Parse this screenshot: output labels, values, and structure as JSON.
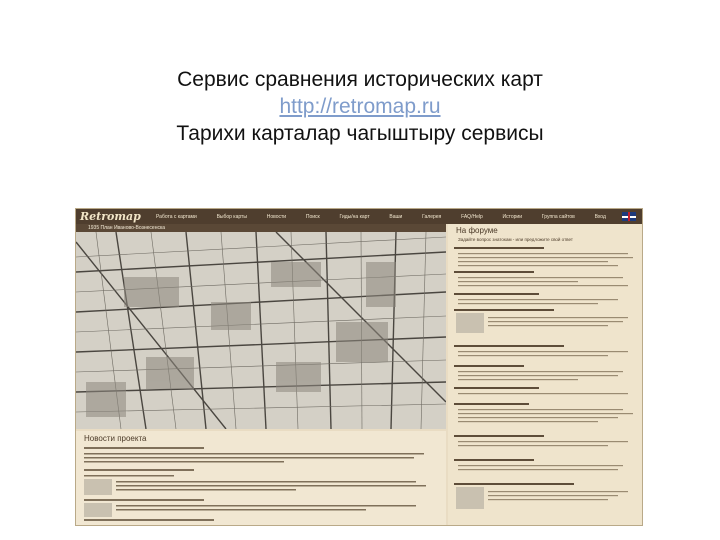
{
  "headline": {
    "line1": "Сервис сравнения исторических карт",
    "url": "http://retromap.ru",
    "line2": "Тарихи карталар чагыштыру сервисы"
  },
  "screenshot": {
    "logo": "Retromap",
    "menu": [
      "Работа с картами",
      "Выбор карты",
      "Новости",
      "Поиск",
      "Гиды/на карт",
      "Ваши",
      "Галерея",
      "FAQ/Help",
      "Истории",
      "Группа сайтов",
      "Вход"
    ],
    "map_title": "1935 План Иваново-Вознесенска",
    "news_heading": "Новости проекта",
    "forum_heading": "На форуме",
    "forum_subheading": "Задайте вопрос знатокам - или предложите свой ответ",
    "colors": {
      "nav": "#4f3e2e",
      "panel": "#efe4cc",
      "map": "#cfcac0",
      "link": "#7f9ccb"
    }
  }
}
